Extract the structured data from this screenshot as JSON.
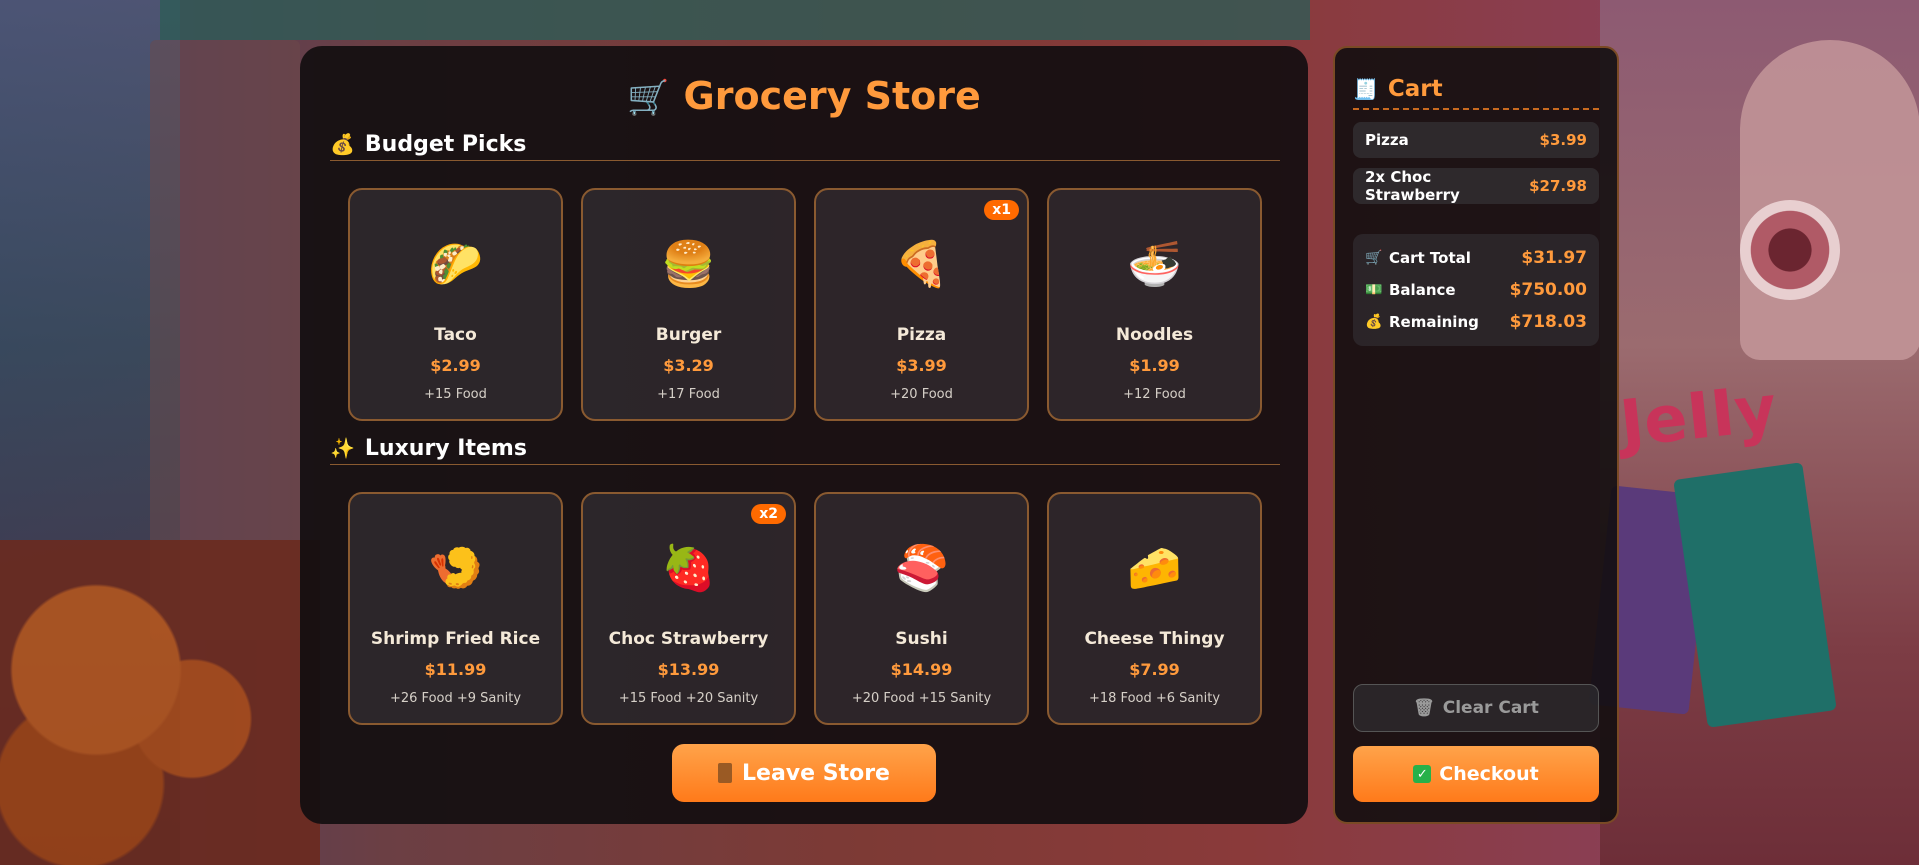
{
  "store": {
    "title": "Grocery Store",
    "icon": "shopping-cart-icon",
    "sections": [
      {
        "title": "Budget Picks",
        "icon": "money-bag-icon",
        "items": [
          {
            "name": "Taco",
            "price": "$2.99",
            "stat": "+15 Food",
            "icon": "🌮",
            "qty": ""
          },
          {
            "name": "Burger",
            "price": "$3.29",
            "stat": "+17 Food",
            "icon": "🍔",
            "qty": ""
          },
          {
            "name": "Pizza",
            "price": "$3.99",
            "stat": "+20 Food",
            "icon": "🍕",
            "qty": "x1"
          },
          {
            "name": "Noodles",
            "price": "$1.99",
            "stat": "+12 Food",
            "icon": "🍜",
            "qty": ""
          }
        ]
      },
      {
        "title": "Luxury Items",
        "icon": "sparkles-icon",
        "items": [
          {
            "name": "Shrimp Fried Rice",
            "price": "$11.99",
            "stat": "+26 Food +9 Sanity",
            "icon": "🍤",
            "qty": ""
          },
          {
            "name": "Choc Strawberry",
            "price": "$13.99",
            "stat": "+15 Food +20 Sanity",
            "icon": "🍓",
            "qty": "x2"
          },
          {
            "name": "Sushi",
            "price": "$14.99",
            "stat": "+20 Food +15 Sanity",
            "icon": "🍣",
            "qty": ""
          },
          {
            "name": "Cheese Thingy",
            "price": "$7.99",
            "stat": "+18 Food +6 Sanity",
            "icon": "🧀",
            "qty": ""
          }
        ]
      }
    ],
    "leave_label": "Leave Store"
  },
  "cart": {
    "title": "Cart",
    "items": [
      {
        "label": "Pizza",
        "amount": "$3.99"
      },
      {
        "label": "2x Choc Strawberry",
        "amount": "$27.98"
      }
    ],
    "summary": [
      {
        "label": "Cart Total",
        "value": "$31.97",
        "icon": "cart-icon"
      },
      {
        "label": "Balance",
        "value": "$750.00",
        "icon": "cash-icon"
      },
      {
        "label": "Remaining",
        "value": "$718.03",
        "icon": "money-bag-icon"
      }
    ],
    "clear_label": "Clear Cart",
    "checkout_label": "Checkout"
  },
  "colors": {
    "accent": "#ff9a3c",
    "badge": "#ff6a00",
    "border": "#8a5a30"
  }
}
